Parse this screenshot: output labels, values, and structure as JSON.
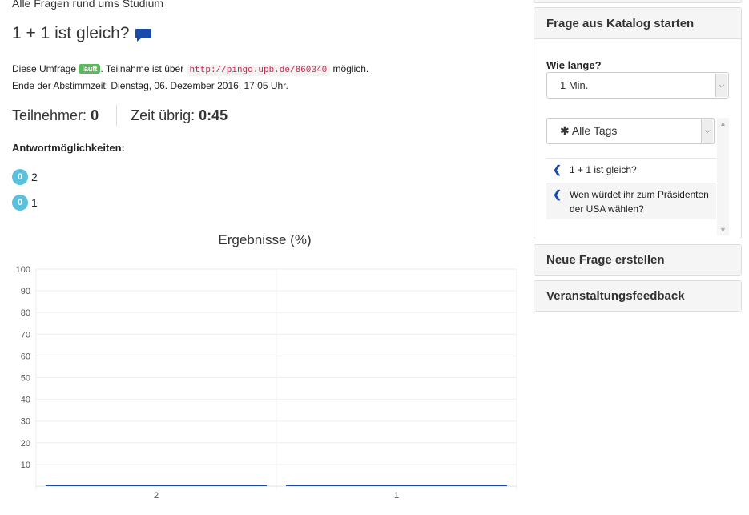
{
  "breadcrumb": "Alle Fragen rund ums Studium",
  "question": {
    "title": "1 + 1 ist gleich?"
  },
  "info": {
    "line1_pre": "Diese Umfrage ",
    "status_badge": "läuft",
    "line1_mid": ". Teilnahme ist über ",
    "url": "http://pingo.upb.de/860340",
    "line1_post": " möglich.",
    "line2": "Ende der Abstimmzeit: Dienstag, 06. Dezember 2016, 17:05 Uhr."
  },
  "stats": {
    "participants_label": "Teilnehmer:",
    "participants_value": "0",
    "time_label": "Zeit übrig:",
    "time_value": "0:45"
  },
  "answers": {
    "label": "Antwortmöglichkeiten:",
    "items": [
      {
        "count": "0",
        "text": "2"
      },
      {
        "count": "0",
        "text": "1"
      }
    ]
  },
  "colors": {
    "accent": "#1a4ba8",
    "badge_green": "#5cb85c",
    "count_blue": "#5bc0de"
  },
  "chart_data": {
    "type": "bar",
    "title": "Ergebnisse (%)",
    "categories": [
      "2",
      "1"
    ],
    "values": [
      0,
      0
    ],
    "ylim": [
      0,
      100
    ],
    "yticks": [
      "100",
      "90",
      "80",
      "70",
      "60",
      "50",
      "40",
      "30",
      "20",
      "10"
    ],
    "grid": true
  },
  "sidebar": {
    "catalog_panel": {
      "title": "Frage aus Katalog starten",
      "duration_label": "Wie lange?",
      "duration_value": "1 Min.",
      "tags_value": "✱ Alle Tags",
      "items": [
        {
          "text": "1 + 1 ist gleich?"
        },
        {
          "text": "Wen würdet ihr zum Präsidenten der USA wählen?"
        }
      ]
    },
    "new_question": "Neue Frage erstellen",
    "feedback": "Veranstaltungsfeedback"
  }
}
